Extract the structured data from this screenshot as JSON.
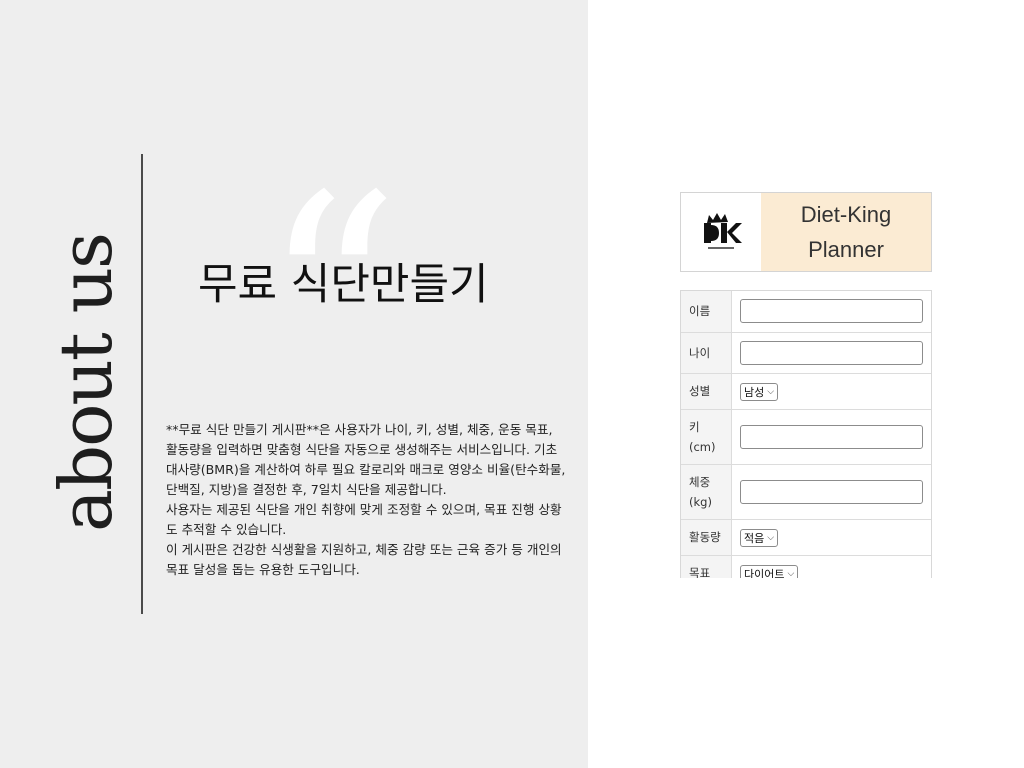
{
  "about": {
    "vertical_label": "about us",
    "quote_glyph": "“",
    "title": "무료 식단만들기",
    "description": [
      "**무료 식단 만들기 게시판**은 사용자가 나이, 키, 성별, 체중, 운동 목표, 활동량을 입력하면 맞춤형 식단을 자동으로 생성해주는 서비스입니다. 기초대사량(BMR)을 계산하여 하루 필요 칼로리와 매크로 영양소 비율(탄수화물, 단백질, 지방)을 결정한 후, 7일치 식단을 제공합니다.",
      "사용자는 제공된 식단을 개인 취향에 맞게 조정할 수 있으며, 목표 진행 상황도 추적할 수 있습니다.",
      "이 게시판은 건강한 식생활을 지원하고, 체중 감량 또는 근육 증가 등 개인의 목표 달성을 돕는 유용한 도구입니다."
    ]
  },
  "app": {
    "logo_icon": "dk-crown-logo",
    "brand_line1": "Diet-King",
    "brand_line2": "Planner",
    "fields": [
      {
        "label": "이름",
        "type": "text",
        "value": ""
      },
      {
        "label": "나이",
        "type": "text",
        "value": ""
      },
      {
        "label": "성별",
        "type": "select",
        "value": "남성"
      },
      {
        "label": "키\n(cm)",
        "type": "text",
        "value": ""
      },
      {
        "label": "체중\n(kg)",
        "type": "text",
        "value": ""
      },
      {
        "label": "활동량",
        "type": "select",
        "value": "적음"
      },
      {
        "label": "목표",
        "type": "select",
        "value": "다이어트"
      }
    ]
  },
  "colors": {
    "left_background": "#eeeeee",
    "brand_background": "#fbebd3"
  }
}
